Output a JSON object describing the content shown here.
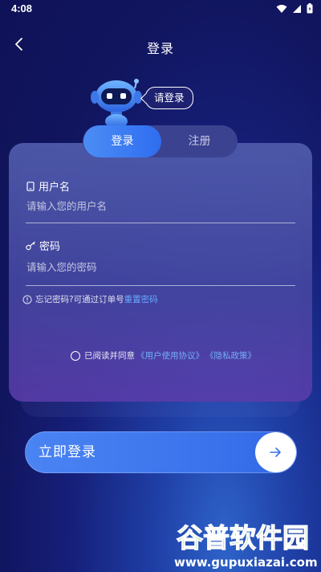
{
  "status_bar": {
    "time": "4:08",
    "icons": [
      "wifi-icon",
      "signal-icon",
      "battery-icon"
    ]
  },
  "header": {
    "title": "登录",
    "back_icon": "chevron-left-icon"
  },
  "robot": {
    "bubble": "请登录"
  },
  "tabs": [
    {
      "label": "登录",
      "active": true
    },
    {
      "label": "注册",
      "active": false
    }
  ],
  "form": {
    "username": {
      "label": "用户名",
      "placeholder": "请输入您的用户名",
      "value": ""
    },
    "password": {
      "label": "密码",
      "placeholder": "请输入您的密码",
      "value": ""
    },
    "forgot": {
      "text": "忘记密码?可通过订单号",
      "link": "重置密码"
    }
  },
  "agreement": {
    "prefix": "已阅读并同意",
    "user_agreement": "《用户使用协议》",
    "privacy": "《隐私政策》",
    "checked": false
  },
  "login_button": {
    "label": "立即登录"
  },
  "watermark": {
    "line1": "谷普软件园",
    "line2": "www.gupuxiazai.com"
  },
  "colors": {
    "accent": "#3a72ec",
    "link": "#68a8ff",
    "background": "#11155e"
  }
}
